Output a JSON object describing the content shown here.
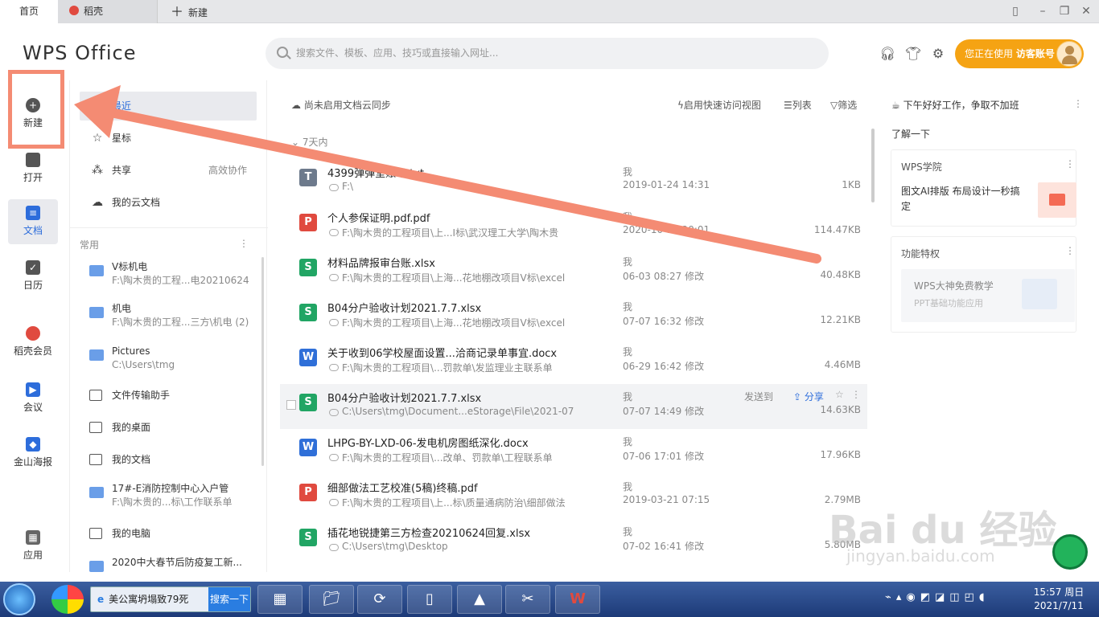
{
  "tabs": [
    {
      "label": "首页"
    },
    {
      "label": "稻壳"
    },
    {
      "label": "新建"
    }
  ],
  "brand": {
    "logo": "WPS Office"
  },
  "search": {
    "placeholder": "搜索文件、模板、应用、技巧或直接输入网址..."
  },
  "account": {
    "prefix": "您正在使用",
    "name": "访客账号"
  },
  "leftnav": [
    {
      "label": "新建"
    },
    {
      "label": "打开"
    },
    {
      "label": "文档"
    },
    {
      "label": "日历"
    },
    {
      "label": "稻壳会员"
    },
    {
      "label": "会议"
    },
    {
      "label": "金山海报"
    },
    {
      "label": "应用"
    }
  ],
  "col2": {
    "recent": "最近",
    "star": "星标",
    "share": "共享",
    "share_extra": "高效协作",
    "cloud": "我的云文档",
    "common": "常用",
    "folders": [
      {
        "name": "V标机电",
        "path": "F:\\陶木贵的工程...电20210624"
      },
      {
        "name": "机电",
        "path": "F:\\陶木贵的工程...三方\\机电 (2)"
      },
      {
        "name": "Pictures",
        "path": "C:\\Users\\tmg"
      }
    ],
    "plain1": "文件传输助手",
    "plain2": "我的桌面",
    "plain3": "我的文档",
    "folder4": {
      "name": "17#-E消防控制中心入户管",
      "path": "F:\\陶木贵的...标\\工作联系单"
    },
    "plain4": "我的电脑",
    "folder5": {
      "name": "2020中大春节后防疫复工新..."
    }
  },
  "main": {
    "sync": "尚未启用文档云同步",
    "quick": "启用快速访问视图",
    "list": "列表",
    "filter": "筛选",
    "group": "7天内",
    "sendto": "发送到",
    "share": "分享",
    "files": [
      {
        "name": "4399弹弹堂账号.txt",
        "path": "F:\\",
        "owner": "我",
        "time": "2019-01-24 14:31",
        "size": "1KB",
        "type": "T",
        "color": "#6d7a8c"
      },
      {
        "name": "个人参保证明.pdf.pdf",
        "path": "F:\\陶木贵的工程项目\\上...Ⅰ标\\武汉理工大学\\陶木贵",
        "owner": "我",
        "time": "2020-10-17 20:01",
        "size": "114.47KB",
        "type": "P",
        "color": "#e04a3f"
      },
      {
        "name": "材料品牌报审台账.xlsx",
        "path": "F:\\陶木贵的工程项目\\上海...花地棚改项目Ⅴ标\\excel",
        "owner": "我",
        "time": "06-03 08:27 修改",
        "size": "40.48KB",
        "type": "S",
        "color": "#21a564"
      },
      {
        "name": "B04分户验收计划2021.7.7.xlsx",
        "path": "F:\\陶木贵的工程项目\\上海...花地棚改项目Ⅴ标\\excel",
        "owner": "我",
        "time": "07-07 16:32 修改",
        "size": "12.21KB",
        "type": "S",
        "color": "#21a564"
      },
      {
        "name": "关于收到06学校屋面设置...洽商记录单事宜.docx",
        "path": "F:\\陶木贵的工程项目\\...罚款单\\发监理业主联系单",
        "owner": "我",
        "time": "06-29 16:42 修改",
        "size": "4.46MB",
        "type": "W",
        "color": "#2f6fd8"
      },
      {
        "name": "B04分户验收计划2021.7.7.xlsx",
        "path": "C:\\Users\\tmg\\Document...eStorage\\File\\2021-07",
        "owner": "我",
        "time": "07-07 14:49 修改",
        "size": "14.63KB",
        "type": "S",
        "color": "#21a564"
      },
      {
        "name": "LHPG-BY-LXD-06-发电机房图纸深化.docx",
        "path": "F:\\陶木贵的工程项目\\...改单、罚款单\\工程联系单",
        "owner": "我",
        "time": "07-06 17:01 修改",
        "size": "17.96KB",
        "type": "W",
        "color": "#2f6fd8"
      },
      {
        "name": "细部做法工艺校准(5稿)终稿.pdf",
        "path": "F:\\陶木贵的工程项目\\上...标\\质量通病防治\\细部做法",
        "owner": "我",
        "time": "2019-03-21 07:15",
        "size": "2.79MB",
        "type": "P",
        "color": "#e04a3f"
      },
      {
        "name": "插花地锐捷第三方检查20210624回复.xlsx",
        "path": "C:\\Users\\tmg\\Desktop",
        "owner": "我",
        "time": "07-02 16:41 修改",
        "size": "5.80MB",
        "type": "S",
        "color": "#21a564"
      }
    ]
  },
  "right": {
    "greeting": "下午好好工作，争取不加班",
    "learn": "了解一下",
    "card1": {
      "title": "WPS学院",
      "text": "图文AI排版 布局设计一秒搞定"
    },
    "card2": {
      "title": "功能特权",
      "main": "WPS大神免费教学",
      "sub": "PPT基础功能应用"
    }
  },
  "taskbar": {
    "ie_text": "美公寓坍塌致79死",
    "ie_button": "搜索一下",
    "time": "15:57 周日",
    "date": "2021/7/11"
  },
  "watermark": {
    "main": "Bai du 经验",
    "sub": "jingyan.baidu.com"
  }
}
